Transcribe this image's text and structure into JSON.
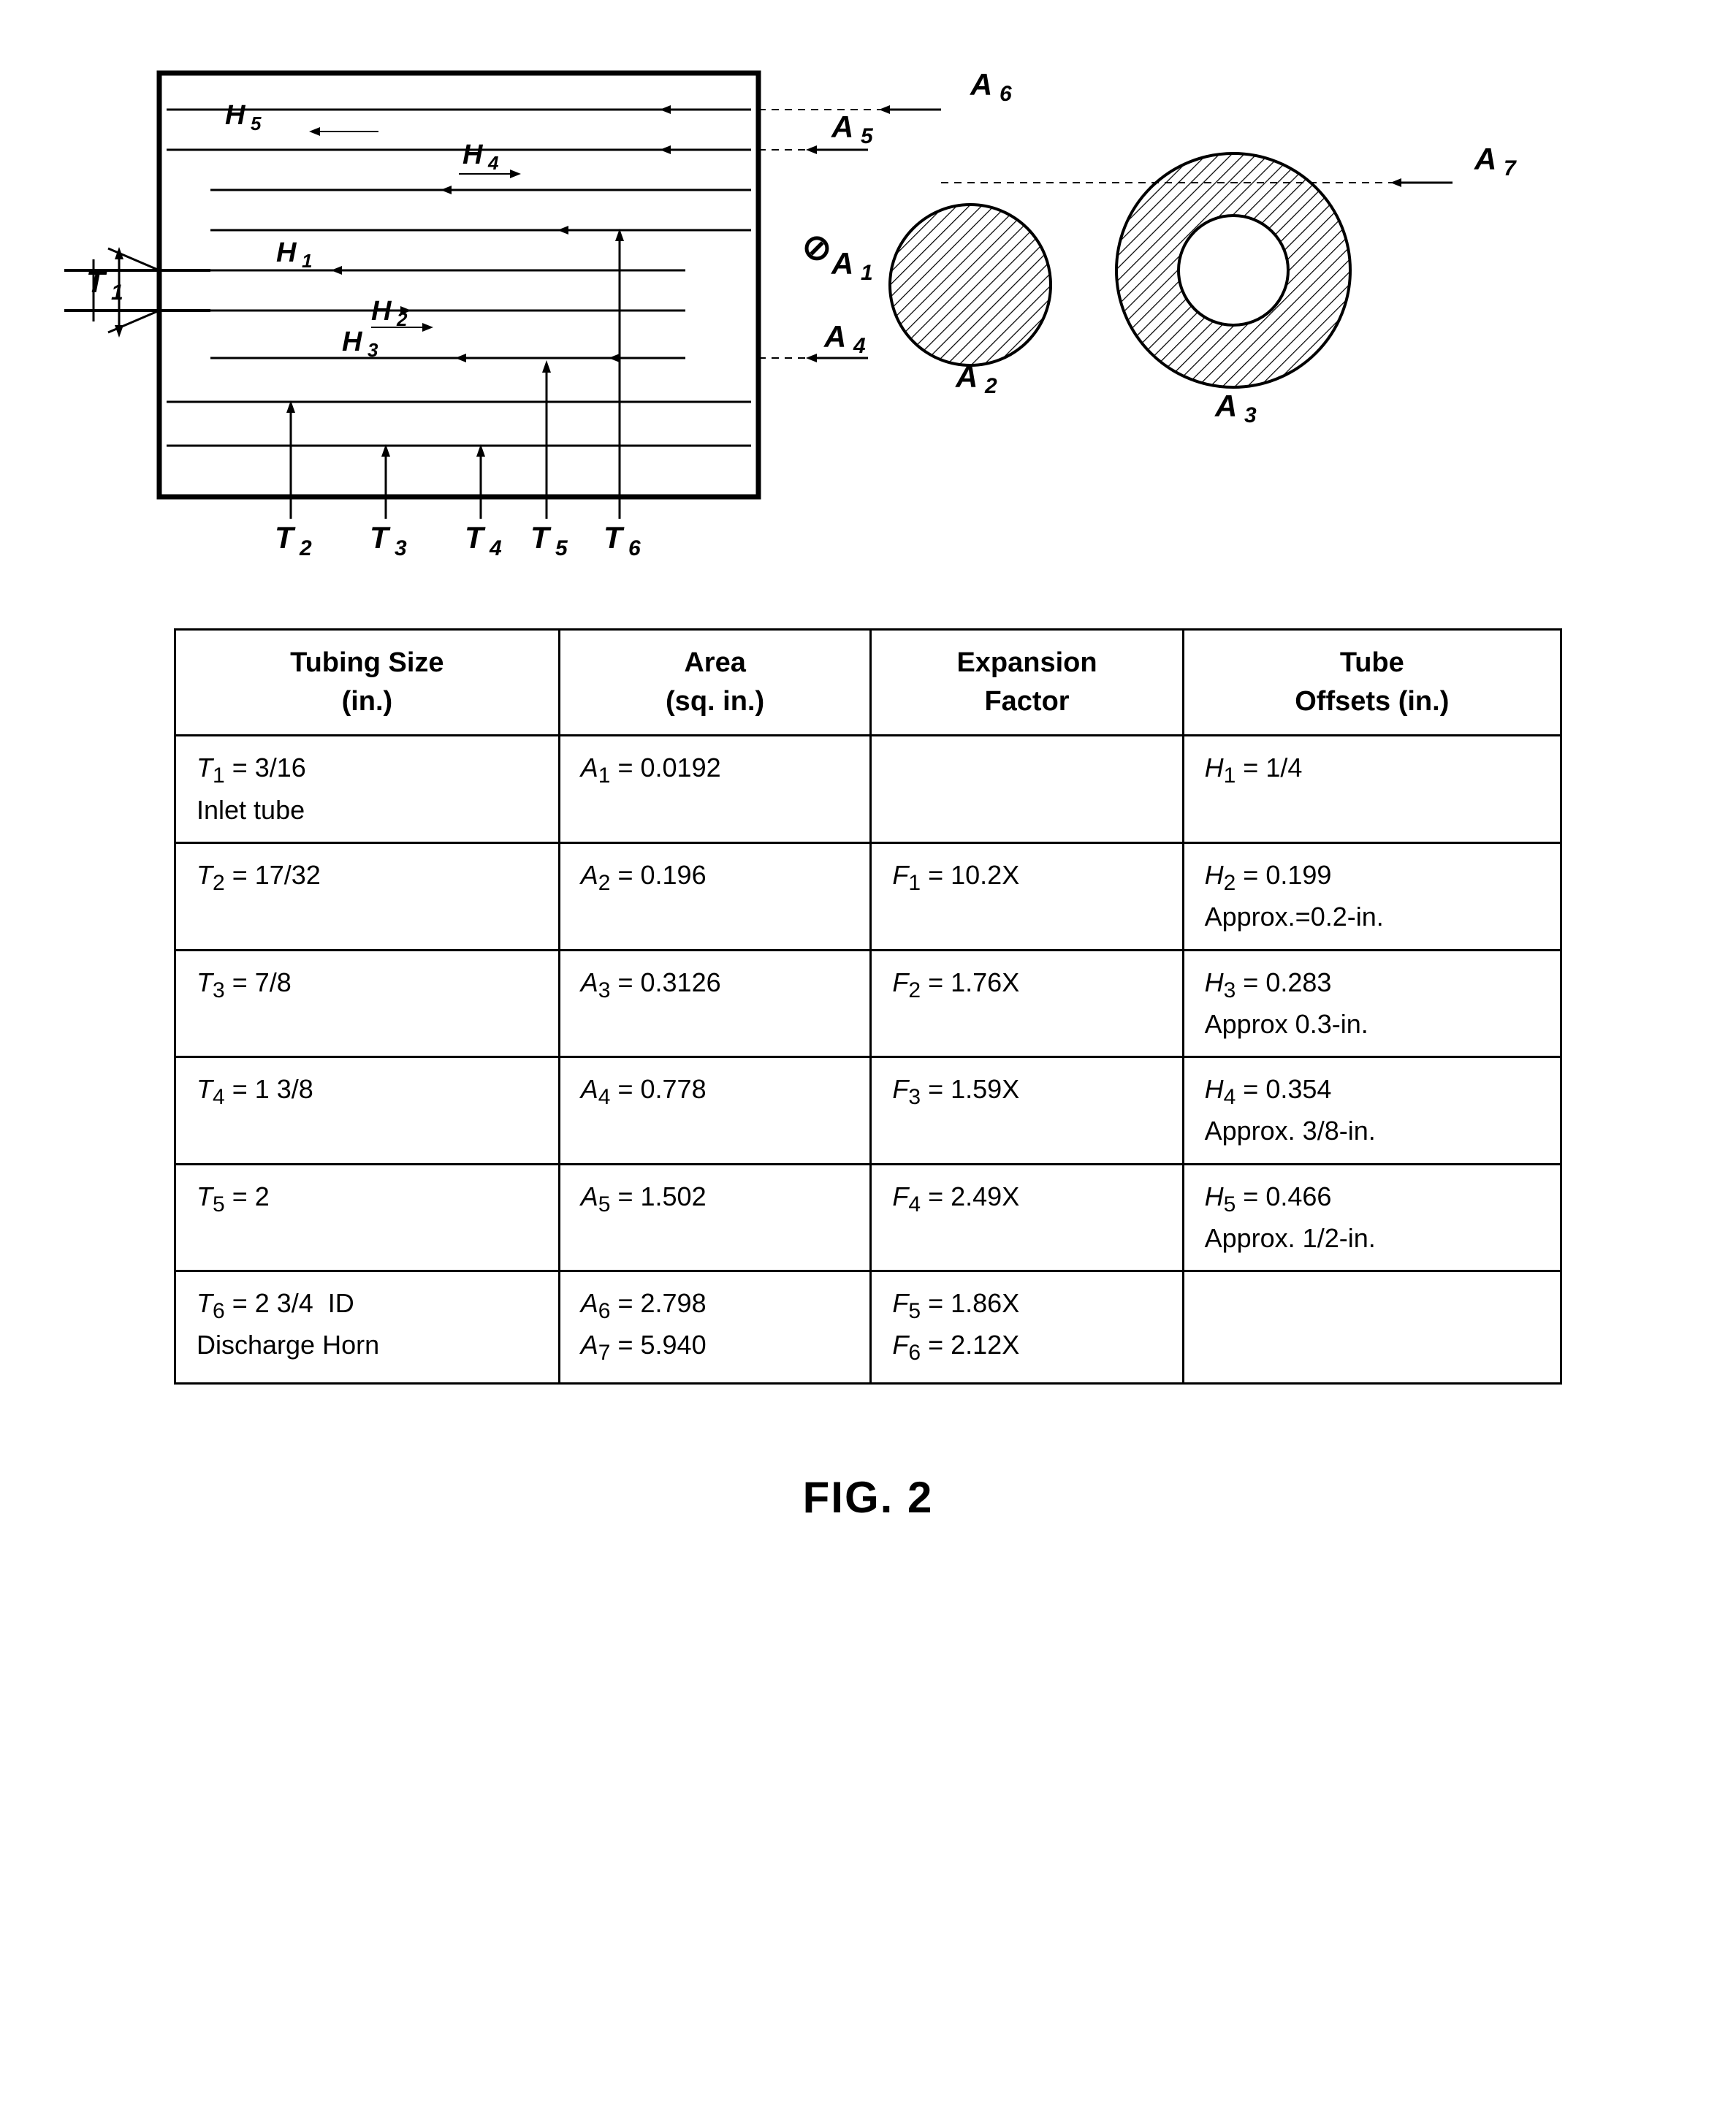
{
  "diagram": {
    "labels": {
      "T1": "T₁",
      "T2": "T₂",
      "T3": "T₃",
      "T4": "T₄",
      "T5": "T₅",
      "T6": "T₆",
      "A1": "A₁",
      "A2": "A₂",
      "A3": "A₃",
      "A4": "A₄",
      "A5": "A₅",
      "A6": "A₆",
      "A7": "A₇",
      "H1": "H₁",
      "H2": "H₂",
      "H3": "H₃",
      "H4": "H₄",
      "H5": "H₅"
    }
  },
  "table": {
    "headers": [
      "Tubing Size (in.)",
      "Area (sq. in.)",
      "Expansion Factor",
      "Tube Offsets (in.)"
    ],
    "rows": [
      {
        "size": "T₁ = 3/16\nInlet tube",
        "area": "A₁ = 0.0192",
        "expansion": "",
        "offset": "H₁ = 1/4"
      },
      {
        "size": "T₂ = 17/32",
        "area": "A₂ = 0.196",
        "expansion": "F₁ = 10.2X",
        "offset": "H₂ = 0.199\nApprox.=0.2-in."
      },
      {
        "size": "T₃ = 7/8",
        "area": "A₃ = 0.3126",
        "expansion": "F₂ = 1.76X",
        "offset": "H₃ = 0.283\nApprox 0.3-in."
      },
      {
        "size": "T₄ = 1 3/8",
        "area": "A₄ = 0.778",
        "expansion": "F₃ = 1.59X",
        "offset": "H₄ = 0.354\nApprox. 3/8-in."
      },
      {
        "size": "T₅ = 2",
        "area": "A₅ = 1.502",
        "expansion": "F₄ = 2.49X",
        "offset": "H₅ = 0.466\nApprox. 1/2-in."
      },
      {
        "size": "T₆ = 2 3/4  ID\nDischarge Horn",
        "area": "A₆ = 2.798\nA₇ = 5.940",
        "expansion": "F₅ = 1.86X\nF₆ = 2.12X",
        "offset": ""
      }
    ]
  },
  "figure_label": "FIG. 2"
}
